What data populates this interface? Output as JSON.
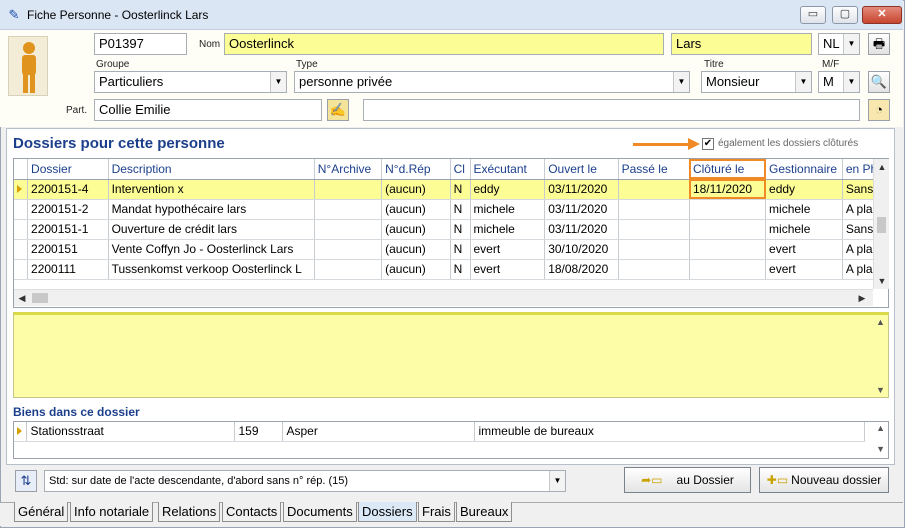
{
  "window": {
    "title": "Fiche Personne - Oosterlinck Lars",
    "controls": {
      "minimize": "▭",
      "maximize": "▢",
      "close": "✕"
    }
  },
  "person": {
    "code": "P01397",
    "nom_label": "Nom",
    "lastname": "Oosterlinck",
    "firstname": "Lars",
    "language": "NL",
    "groupe_label": "Groupe",
    "groupe": "Particuliers",
    "type_label": "Type",
    "type": "personne privée",
    "titre_label": "Titre",
    "titre": "Monsieur",
    "mf_label": "M/F",
    "mf": "M",
    "part_label": "Part.",
    "partner": "Collie Emilie",
    "extra": ""
  },
  "dossiers": {
    "section_title": "Dossiers pour cette personne",
    "show_closed_label": "également les dossiers clôturés",
    "show_closed_checked": true,
    "columns": [
      "Dossier",
      "Description",
      "N°Archive",
      "N°d.Rép",
      "Cl",
      "Exécutant",
      "Ouvert le",
      "Passé le",
      "Clôturé le",
      "Gestionnaire",
      "en Pha"
    ],
    "rows": [
      {
        "dossier": "2200151-4",
        "description": "Intervention x",
        "archive": "",
        "rep": "(aucun)",
        "cl": "N",
        "executant": "eddy",
        "ouvert": "03/11/2020",
        "passe": "",
        "cloture": "18/11/2020",
        "gestionnaire": "eddy",
        "phase": "Sans f"
      },
      {
        "dossier": "2200151-2",
        "description": "Mandat hypothécaire  lars",
        "archive": "",
        "rep": "(aucun)",
        "cl": "N",
        "executant": "michele",
        "ouvert": "03/11/2020",
        "passe": "",
        "cloture": "",
        "gestionnaire": "michele",
        "phase": "A plan"
      },
      {
        "dossier": "2200151-1",
        "description": "Ouverture de crédit  lars",
        "archive": "",
        "rep": "(aucun)",
        "cl": "N",
        "executant": "michele",
        "ouvert": "03/11/2020",
        "passe": "",
        "cloture": "",
        "gestionnaire": "michele",
        "phase": "Sans f"
      },
      {
        "dossier": "2200151",
        "description": "Vente Coffyn Jo - Oosterlinck Lars",
        "archive": "",
        "rep": "(aucun)",
        "cl": "N",
        "executant": "evert",
        "ouvert": "30/10/2020",
        "passe": "",
        "cloture": "",
        "gestionnaire": "evert",
        "phase": "A plan"
      },
      {
        "dossier": "2200111",
        "description": "Tussenkomst verkoop Oosterlinck L",
        "archive": "",
        "rep": "(aucun)",
        "cl": "N",
        "executant": "evert",
        "ouvert": "18/08/2020",
        "passe": "",
        "cloture": "",
        "gestionnaire": "evert",
        "phase": "A plan"
      }
    ]
  },
  "biens": {
    "title": "Biens dans ce dossier",
    "rows": [
      {
        "street": "Stationsstraat",
        "number": "159",
        "city": "Asper",
        "kind": "immeuble de bureaux"
      }
    ]
  },
  "footer": {
    "sort": "Std: sur date de l'acte descendante, d'abord sans n° rép. (15)",
    "au_dossier": "au Dossier",
    "nouveau_dossier": "Nouveau dossier"
  },
  "tabs": [
    "Général",
    "Info notariale",
    "Relations",
    "Contacts",
    "Documents",
    "Dossiers",
    "Frais",
    "Bureaux"
  ],
  "active_tab": "Dossiers",
  "colors": {
    "highlight": "#fdfd96",
    "accent": "#1c3f8c",
    "annotation": "#f08a24"
  }
}
